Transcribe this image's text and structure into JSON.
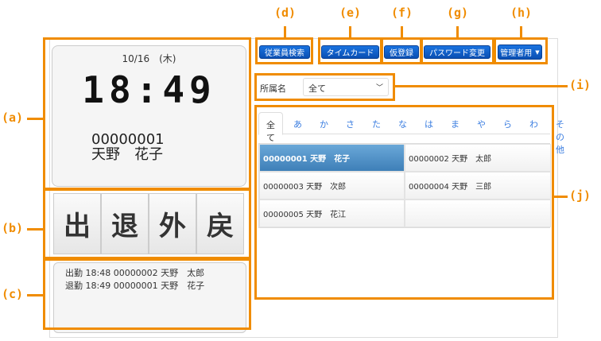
{
  "callouts": [
    "(a)",
    "(b)",
    "(c)",
    "(d)",
    "(e)",
    "(f)",
    "(g)",
    "(h)",
    "(i)",
    "(j)"
  ],
  "clock": {
    "date": "10/16　(木)",
    "time": "18:49",
    "employee_id": "00000001",
    "employee_name": "天野　花子"
  },
  "punch_buttons": [
    "出",
    "退",
    "外",
    "戻"
  ],
  "log": [
    "出勤 18:48 00000002 天野　太郎",
    "退勤 18:49 00000001 天野　花子"
  ],
  "toolbar": {
    "employee_search": "従業員検索",
    "timecard": "タイムカード",
    "provisional": "仮登録",
    "password": "パスワード変更",
    "admin": "管理者用"
  },
  "filter": {
    "label": "所属名",
    "value": "全て"
  },
  "tabs": [
    "全て",
    "あ",
    "か",
    "さ",
    "た",
    "な",
    "は",
    "ま",
    "や",
    "ら",
    "わ",
    "その他"
  ],
  "active_tab": "全て",
  "employees": [
    "00000001 天野　花子",
    "00000002 天野　太郎",
    "00000003 天野　次郎",
    "00000004 天野　三郎",
    "00000005 天野　花江",
    ""
  ],
  "selected_employee": "00000001 天野　花子",
  "colors": {
    "callout": "#f08c00",
    "button": "#0a5fcc",
    "selected_row": "#4f8fc6"
  }
}
